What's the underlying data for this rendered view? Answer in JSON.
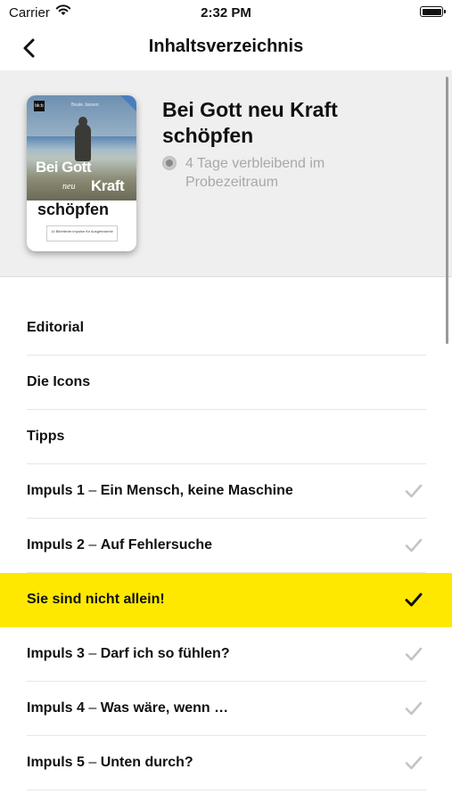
{
  "status_bar": {
    "carrier": "Carrier",
    "time": "2:32 PM"
  },
  "nav": {
    "title": "Inhaltsverzeichnis",
    "back_icon": "chevron-left-icon"
  },
  "book": {
    "title": "Bei Gott neu Kraft schöpfen",
    "status": "4 Tage verbleibend im Probezeitraum",
    "cover": {
      "logo": "bk:b",
      "author": "Beate Jansen",
      "line1": "Bei Gott",
      "line2": "neu",
      "line3": "Kraft",
      "line4": "schöpfen",
      "box_text": "14 Bibeltexte impulse für Ausgebrannte"
    }
  },
  "toc": [
    {
      "prefix": "",
      "dash": "",
      "title": "Editorial",
      "state": "none"
    },
    {
      "prefix": "",
      "dash": "",
      "title": "Die Icons",
      "state": "none"
    },
    {
      "prefix": "",
      "dash": "",
      "title": "Tipps",
      "state": "none"
    },
    {
      "prefix": "Impuls 1",
      "dash": " – ",
      "title": "Ein Mensch, keine Maschine",
      "state": "read"
    },
    {
      "prefix": "Impuls 2",
      "dash": " – ",
      "title": "Auf Fehlersuche",
      "state": "read"
    },
    {
      "prefix": "",
      "dash": "",
      "title": "Sie sind nicht allein!",
      "state": "active"
    },
    {
      "prefix": "Impuls 3",
      "dash": " – ",
      "title": "Darf ich so fühlen?",
      "state": "read"
    },
    {
      "prefix": "Impuls 4",
      "dash": " – ",
      "title": "Was wäre, wenn …",
      "state": "read"
    },
    {
      "prefix": "Impuls 5",
      "dash": " – ",
      "title": "Unten durch?",
      "state": "read"
    }
  ],
  "colors": {
    "highlight": "#ffe800",
    "check_read": "#c4c4c4",
    "check_active": "#111111"
  }
}
